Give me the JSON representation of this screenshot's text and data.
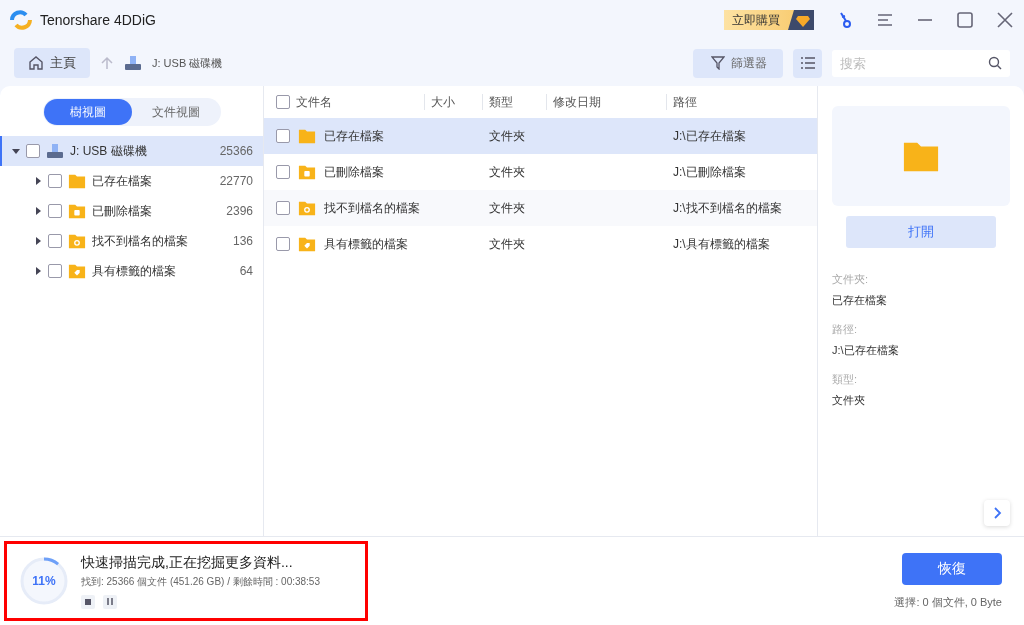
{
  "window": {
    "title": "Tenorshare 4DDiG",
    "buy_label": "立即購買"
  },
  "toolbar": {
    "home": "主頁",
    "location": "J: USB 磁碟機",
    "filter": "篩選器",
    "search_placeholder": "搜索"
  },
  "view_tabs": [
    {
      "label": "樹視圖",
      "selected": true
    },
    {
      "label": "文件視圖",
      "selected": false
    }
  ],
  "tree": {
    "label": "J: USB 磁碟機",
    "count": "25366",
    "expanded": true,
    "selected": true,
    "checked": false,
    "children": [
      {
        "label": "已存在檔案",
        "count": "22770",
        "kind": "existing",
        "checked": false,
        "expanded": false
      },
      {
        "label": "已刪除檔案",
        "count": "2396",
        "kind": "deleted",
        "checked": false,
        "expanded": false
      },
      {
        "label": "找不到檔名的檔案",
        "count": "136",
        "kind": "unnamed",
        "checked": false,
        "expanded": false
      },
      {
        "label": "具有標籤的檔案",
        "count": "64",
        "kind": "tagged",
        "checked": false,
        "expanded": false
      }
    ]
  },
  "table": {
    "select_all_checked": false,
    "columns": [
      "文件名",
      "大小",
      "類型",
      "修改日期",
      "路徑"
    ],
    "rows": [
      {
        "name": "已存在檔案",
        "type": "文件夾",
        "path": "J:\\已存在檔案",
        "kind": "existing",
        "selected": true,
        "checked": false
      },
      {
        "name": "已刪除檔案",
        "type": "文件夾",
        "path": "J:\\已刪除檔案",
        "kind": "deleted",
        "selected": false,
        "checked": false
      },
      {
        "name": "找不到檔名的檔案",
        "type": "文件夾",
        "path": "J:\\找不到檔名的檔案",
        "kind": "unnamed",
        "selected": false,
        "checked": false
      },
      {
        "name": "具有標籤的檔案",
        "type": "文件夾",
        "path": "J:\\具有標籤的檔案",
        "kind": "tagged",
        "selected": false,
        "checked": false
      }
    ]
  },
  "preview": {
    "open": "打開",
    "details": [
      {
        "label": "文件夾:",
        "value": "已存在檔案"
      },
      {
        "label": "路徑:",
        "value": "J:\\已存在檔案"
      },
      {
        "label": "類型:",
        "value": "文件夾"
      }
    ]
  },
  "scan": {
    "percent": "11%",
    "level": 0.11,
    "title": "快速掃描完成,正在挖掘更多資料...",
    "info": "找到: 25366 個文件 (451.26 GB) /  剩餘時間 : 00:38:53"
  },
  "recover": {
    "label": "恢復",
    "summary": "選擇: 0 個文件, 0 Byte"
  }
}
